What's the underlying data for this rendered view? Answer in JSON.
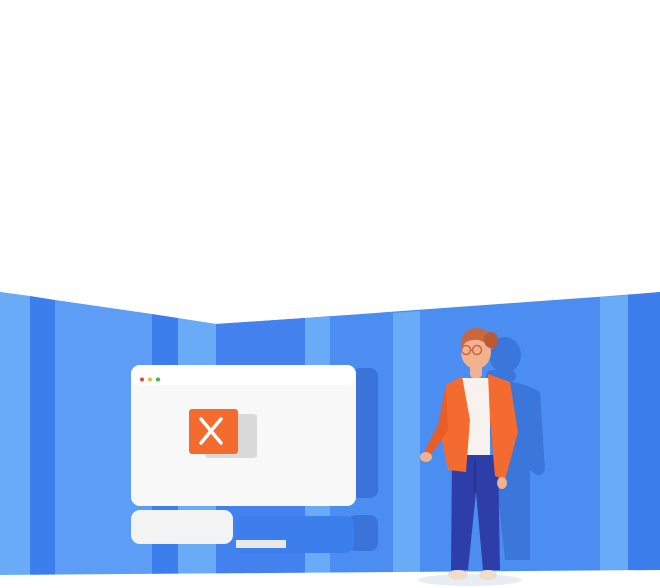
{
  "illustration": {
    "subject": "error-window-with-person",
    "icons": {
      "window_dots": [
        "dot-red",
        "dot-yellow",
        "dot-green"
      ],
      "error": "close-x-icon"
    },
    "colors": {
      "wall_light": "#6AABF8",
      "wall_mid": "#4C8DF2",
      "wall_dark": "#3C7EEC",
      "wall_shadow": "#3A74D8",
      "window": "#F8F8F8",
      "error_orange": "#F36B2F",
      "dot_red": "#E0463A",
      "dot_yellow": "#F2B63A",
      "dot_green": "#3DB54A",
      "jacket": "#F36B2F",
      "jeans": "#2D3EA8",
      "skin": "#F2B28F",
      "hair": "#C9673E"
    }
  }
}
